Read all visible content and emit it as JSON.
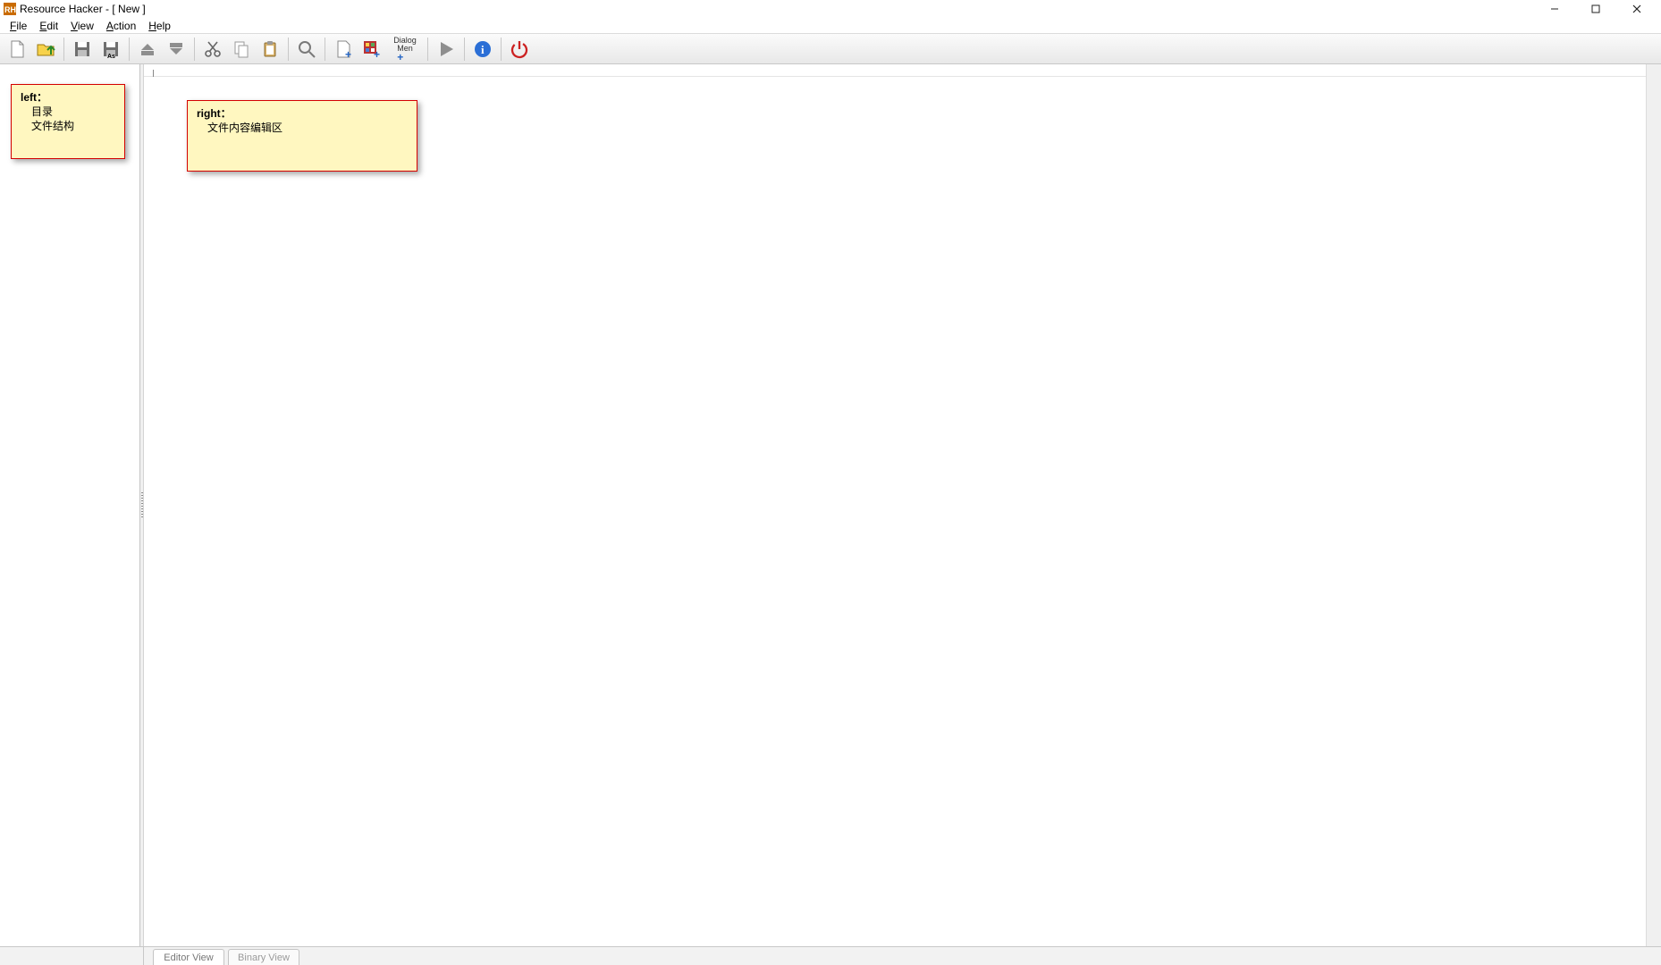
{
  "titlebar": {
    "app_icon_label": "RH",
    "title": "Resource Hacker - [ New ]"
  },
  "menubar": {
    "items": [
      {
        "label": "File",
        "hotkey_index": 0
      },
      {
        "label": "Edit",
        "hotkey_index": 0
      },
      {
        "label": "View",
        "hotkey_index": 0
      },
      {
        "label": "Action",
        "hotkey_index": 0
      },
      {
        "label": "Help",
        "hotkey_index": 0
      }
    ]
  },
  "toolbar": {
    "dialog_menu_label_line1": "Dialog",
    "dialog_menu_label_line2": "Men"
  },
  "annotations": {
    "left": {
      "head": "left：",
      "line1": "目录",
      "line2": "文件结构"
    },
    "right": {
      "head": "right：",
      "line1": "文件内容编辑区"
    }
  },
  "bottom_tabs": {
    "editor": "Editor View",
    "binary": "Binary View"
  }
}
